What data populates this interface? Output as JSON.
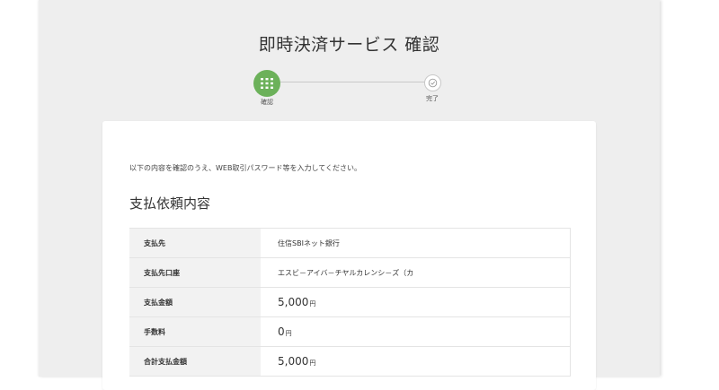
{
  "page": {
    "title": "即時決済サービス 確認"
  },
  "stepper": {
    "steps": [
      {
        "label": "確認",
        "state": "active",
        "icon": "grid-icon"
      },
      {
        "label": "完了",
        "state": "pending",
        "icon": "check-circle-icon"
      }
    ]
  },
  "content": {
    "instruction": "以下の内容を確認のうえ、WEB取引パスワード等を入力してください。",
    "section_title": "支払依頼内容",
    "rows": [
      {
        "label": "支払先",
        "value": "住信SBIネット銀行"
      },
      {
        "label": "支払先口座",
        "value": "エスビ－アイバ－チヤルカレンシ－ズ（カ"
      },
      {
        "label": "支払金額",
        "amount": "5,000",
        "unit": "円"
      },
      {
        "label": "手数料",
        "amount": "0",
        "unit": "円"
      },
      {
        "label": "合計支払金額",
        "amount": "5,000",
        "unit": "円"
      }
    ]
  },
  "colors": {
    "accent": "#6cb15a",
    "frame_background": "#eeeeee",
    "card_background": "#ffffff",
    "header_cell": "#f2f2f2"
  }
}
